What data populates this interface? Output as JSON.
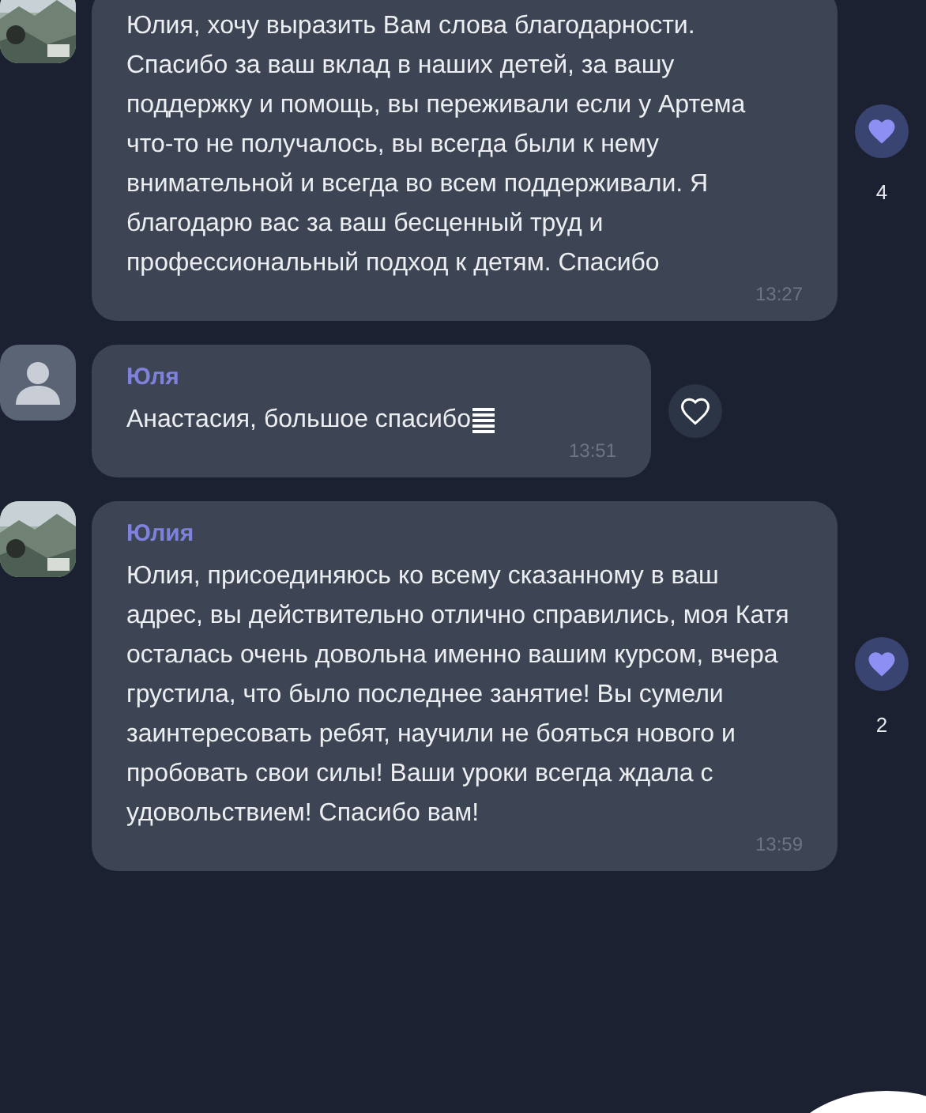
{
  "messages": [
    {
      "text": "Юлия, хочу выразить Вам слова благодарности. Спасибо за ваш вклад в наших детей, за вашу поддержку и помощь, вы переживали если у Артема что-то не получалось, вы всегда были к нему внимательной и всегда во всем поддерживали. Я благодарю вас за ваш бесценный труд и профессиональный подход к детям. Спасибо",
      "time": "13:27",
      "reaction": {
        "reacted": true,
        "count": "4"
      }
    },
    {
      "avatar": {
        "kind": "default"
      },
      "sender": "Юля",
      "text": "Анастасия, большое спасибо",
      "emoji": true,
      "time": "13:51",
      "reaction": {
        "reacted": false
      }
    },
    {
      "sender": "Юлия",
      "text": "Юлия, присоединяюсь ко всему сказанному в ваш адрес, вы действительно отлично справились, моя Катя осталась очень довольна именно вашим курсом, вчера грустила, что было последнее занятие! Вы сумели заинтересовать ребят, научили не бояться нового и пробовать свои силы! Ваши уроки всегда ждала с удовольствием! Спасибо вам!",
      "time": "13:59",
      "reaction": {
        "reacted": true,
        "count": "2"
      }
    }
  ],
  "floating_button": true
}
